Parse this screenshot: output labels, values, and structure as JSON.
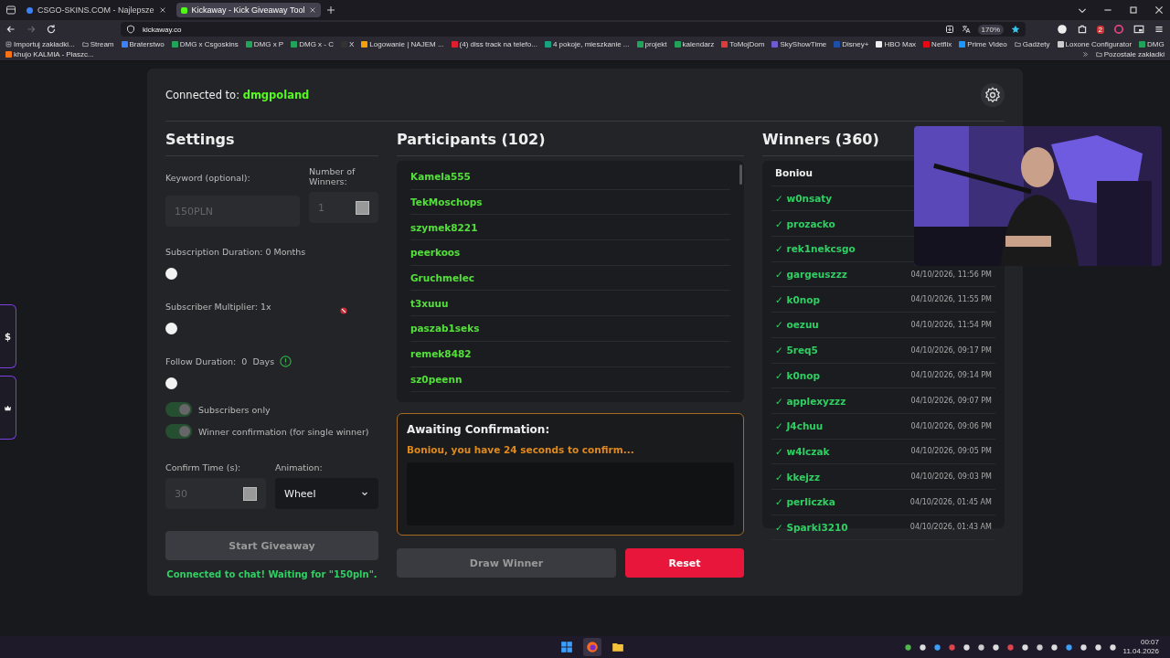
{
  "browser": {
    "tabs": [
      {
        "title": "CSGO-SKINS.COM - Najlepsze",
        "selected": false
      },
      {
        "title": "Kickaway - Kick Giveaway Tool",
        "selected": true
      }
    ],
    "url": "kickaway.co",
    "zoom": "170%",
    "extension_badge": "2",
    "bookmarks": [
      {
        "kind": "import",
        "label": "Importuj zakładki..."
      },
      {
        "kind": "folder",
        "label": "Stream"
      },
      {
        "kind": "site",
        "label": "Braterstwo",
        "color": "#3b82f6"
      },
      {
        "kind": "site",
        "label": "DMG x Csgoskins",
        "color": "#22a35a"
      },
      {
        "kind": "site",
        "label": "DMG x P",
        "color": "#22a35a"
      },
      {
        "kind": "site",
        "label": "DMG x - C",
        "color": "#22a35a"
      },
      {
        "kind": "site",
        "label": "X",
        "color": "#333333"
      },
      {
        "kind": "site",
        "label": "Logowanie | NAJEM ...",
        "color": "#f59e0b"
      },
      {
        "kind": "site",
        "label": "(4) diss track na telefo...",
        "color": "#e11d2e"
      },
      {
        "kind": "site",
        "label": "4 pokoje, mieszkanie ...",
        "color": "#16a37f"
      },
      {
        "kind": "site",
        "label": "projekt",
        "color": "#22a35a"
      },
      {
        "kind": "site",
        "label": "kalendarz",
        "color": "#22a35a"
      },
      {
        "kind": "site",
        "label": "ToMojDom",
        "color": "#e03a3a"
      },
      {
        "kind": "site",
        "label": "SkyShowTime",
        "color": "#6d5bd0"
      },
      {
        "kind": "site",
        "label": "Disney+",
        "color": "#1e4fa8"
      },
      {
        "kind": "site",
        "label": "HBO Max",
        "color": "#eeeeee"
      },
      {
        "kind": "site",
        "label": "Netflix",
        "color": "#e50914"
      },
      {
        "kind": "site",
        "label": "Prime Video",
        "color": "#1a98ff"
      },
      {
        "kind": "folder",
        "label": "Gadżety"
      },
      {
        "kind": "site",
        "label": "Loxone Configurator",
        "color": "#cccccc"
      },
      {
        "kind": "site",
        "label": "DMG",
        "color": "#22a35a"
      },
      {
        "kind": "site",
        "label": "khujo KALMIA - Płaszc...",
        "color": "#f97316"
      }
    ],
    "other_bookmarks": "Pozostałe zakładki"
  },
  "header": {
    "connected_label": "Connected to:",
    "channel": "dmgpoland"
  },
  "side_tabs": [
    {
      "kind": "dollar",
      "label": "$"
    },
    {
      "kind": "crown"
    }
  ],
  "settings": {
    "title": "Settings",
    "keyword": {
      "label": "Keyword (optional):",
      "placeholder": "150PLN"
    },
    "winner_count": {
      "label": "Number of Winners:",
      "placeholder": "1"
    },
    "sliders": [
      {
        "kind": "plain",
        "label": "Subscription Duration: 0 Months",
        "level": 0
      },
      {
        "kind": "plain",
        "label": "Subscriber Multiplier: 1x",
        "level": 0
      },
      {
        "kind": "info",
        "label": "Follow Duration:  0  Days",
        "level": 0
      }
    ],
    "toggles": [
      {
        "label": "Subscribers only",
        "on": true,
        "disabled": true
      },
      {
        "label": "Winner confirmation (for single winner)",
        "on": true,
        "disabled": true
      }
    ],
    "confirm_time": {
      "label": "Confirm Time (s):",
      "placeholder": "30"
    },
    "animation": {
      "label": "Animation:",
      "value": "Wheel"
    },
    "start_button": "Start Giveaway",
    "status": "Connected to chat! Waiting for \"150pln\"."
  },
  "participants": {
    "title": "Participants (102)",
    "names": [
      "Kamela555",
      "TekMoschops",
      "szymek8221",
      "peerkoos",
      "Gruchmelec",
      "t3xuuu",
      "paszab1seks",
      "remek8482",
      "sz0peenn"
    ]
  },
  "confirmation": {
    "title": "Awaiting Confirmation:",
    "message": "Boniou, you have 24 seconds to confirm..."
  },
  "actions": {
    "draw": "Draw Winner",
    "reset": "Reset"
  },
  "winners": {
    "title": "Winners (360)",
    "current": "Boniou",
    "list": [
      {
        "name": "✓ w0nsaty"
      },
      {
        "name": "✓ prozacko"
      },
      {
        "name": "✓ rek1nekcsgo"
      },
      {
        "name": "✓ gargeuszzz",
        "date": "04/10/2026, 11:56 PM"
      },
      {
        "name": "✓ k0nop",
        "date": "04/10/2026, 11:55 PM"
      },
      {
        "name": "✓ oezuu",
        "date": "04/10/2026, 11:54 PM"
      },
      {
        "name": "✓ 5req5",
        "date": "04/10/2026, 09:17 PM"
      },
      {
        "name": "✓ k0nop",
        "date": "04/10/2026, 09:14 PM"
      },
      {
        "name": "✓ applexyzzz",
        "date": "04/10/2026, 09:07 PM"
      },
      {
        "name": "✓ J4chuu",
        "date": "04/10/2026, 09:06 PM"
      },
      {
        "name": "✓ w4lczak",
        "date": "04/10/2026, 09:05 PM"
      },
      {
        "name": "✓ kkejzz",
        "date": "04/10/2026, 09:03 PM"
      },
      {
        "name": "✓ perliczka",
        "date": "04/10/2026, 01:45 AM"
      },
      {
        "name": "✓ Sparki3210",
        "date": "04/10/2026, 01:43 AM"
      }
    ]
  },
  "taskbar": {
    "time": "00:07",
    "date": "11.04.2026"
  }
}
